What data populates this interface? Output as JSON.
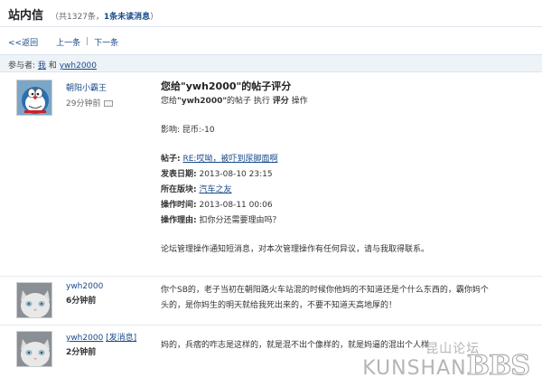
{
  "header": {
    "title": "站内信",
    "count_text": "（共1327条，",
    "unread_text": "1条未读消息",
    "count_end": "）"
  },
  "nav": {
    "back": "<<返回",
    "prev": "上一条",
    "sep": "|",
    "next": "下一条"
  },
  "participants": {
    "label": "参与者:",
    "me": "我",
    "and": "和",
    "other": "ywh2000"
  },
  "messages": [
    {
      "sender": "朝阳小霸王",
      "time": "29分钟前",
      "subject": "您给\"ywh2000\"的帖子评分",
      "body": {
        "line1_pre": "您给",
        "line1_user": "\"ywh2000\"",
        "line1_mid": "的帖子 执行 ",
        "line1_action": "评分",
        "line1_end": " 操作",
        "effect": "影响: 昆币:-10",
        "post_label": "帖子:",
        "post_value": "RE:哎呦，被吓到尿脚面啊",
        "date_label": "发表日期:",
        "date_value": "2013-08-10 23:15",
        "board_label": "所在版块:",
        "board_value": "汽车之友",
        "optime_label": "操作时间:",
        "optime_value": "2013-08-11 00:06",
        "reason_label": "操作理由:",
        "reason_value": "扣你分还需要理由吗？",
        "notice": "论坛管理操作通知短消息，对本次管理操作有任何异议，请与我取得联系。"
      }
    },
    {
      "sender": "ywh2000",
      "time": "6分钟前",
      "text_line1": "你个SB的，老子当初在朝阳路火车站混的时候你他妈的不知道还是个什么东西的，霸你妈个",
      "text_line2": "头的，是你妈生的明天就给我死出来的，不要不知道天高地厚的！"
    },
    {
      "sender": "ywh2000",
      "sender_action": "[发消息]",
      "time": "2分钟前",
      "text_line1": "妈的，兵痞的咋志是这样的，就是混不出个像样的，就是妈逼的混出个人样"
    }
  ],
  "watermark": {
    "top": "昆山论坛",
    "main": "KUNSHAN",
    "bbs": "BBS"
  },
  "colors": {
    "link": "#1a4a8a",
    "band": "#eef3f8"
  }
}
